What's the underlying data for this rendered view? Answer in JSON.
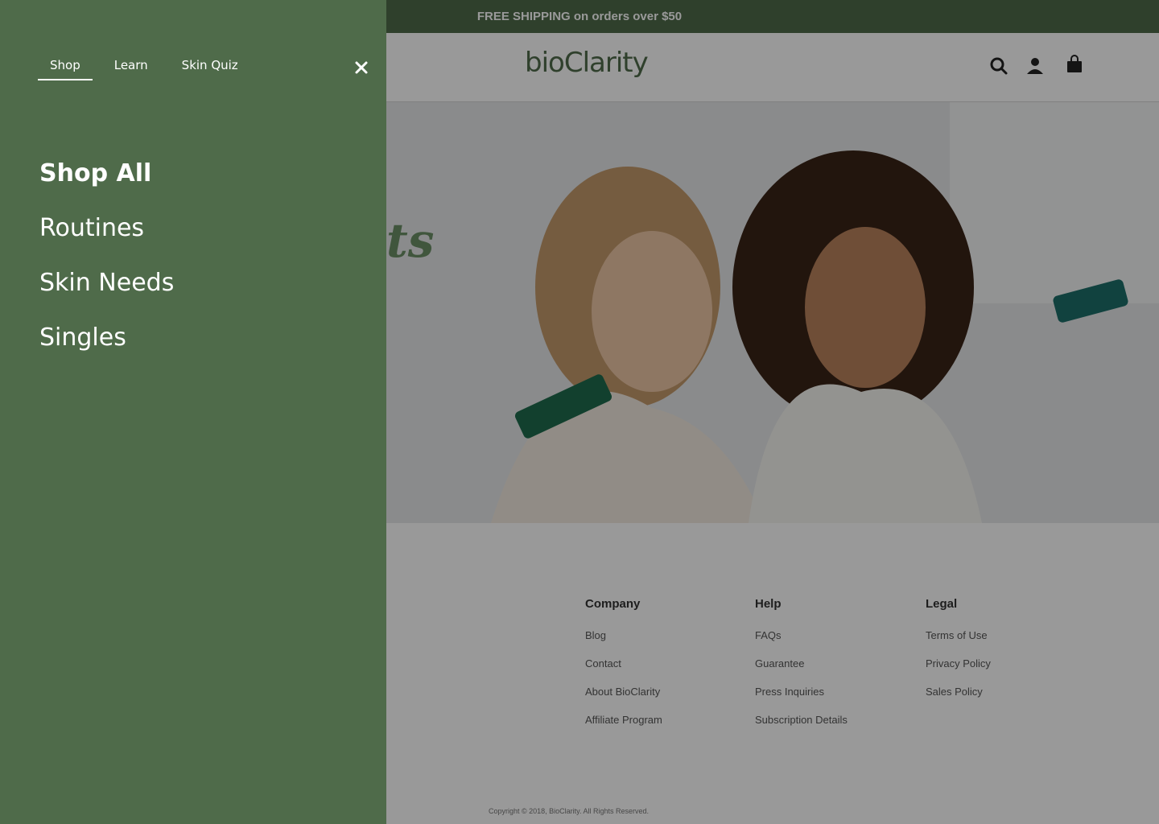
{
  "announcement": {
    "text": "FREE SHIPPING on orders over $50"
  },
  "brand": {
    "logo_text": "bioClarity"
  },
  "header_icons": [
    "search-icon",
    "account-icon",
    "cart-icon"
  ],
  "hero": {
    "script_text": "ts"
  },
  "footer": {
    "columns": [
      {
        "title": "Company",
        "links": [
          "Blog",
          "Contact",
          "About BioClarity",
          "Affiliate Program"
        ]
      },
      {
        "title": "Help",
        "links": [
          "FAQs",
          "Guarantee",
          "Press Inquiries",
          "Subscription Details"
        ]
      },
      {
        "title": "Legal",
        "links": [
          "Terms of Use",
          "Privacy Policy",
          "Sales Policy"
        ]
      }
    ],
    "copyright": "Copyright © 2018, BioClarity. All Rights Reserved."
  },
  "drawer": {
    "tabs": [
      {
        "label": "Shop",
        "active": true
      },
      {
        "label": "Learn",
        "active": false
      },
      {
        "label": "Skin Quiz",
        "active": false
      }
    ],
    "close_icon": "close-icon",
    "menu": [
      {
        "label": "Shop All",
        "bold": true
      },
      {
        "label": "Routines",
        "bold": false
      },
      {
        "label": "Skin Needs",
        "bold": false
      },
      {
        "label": "Singles",
        "bold": false
      }
    ]
  },
  "colors": {
    "brand_green": "#4f6b4a",
    "overlay": "rgba(0,0,0,0.4)"
  }
}
